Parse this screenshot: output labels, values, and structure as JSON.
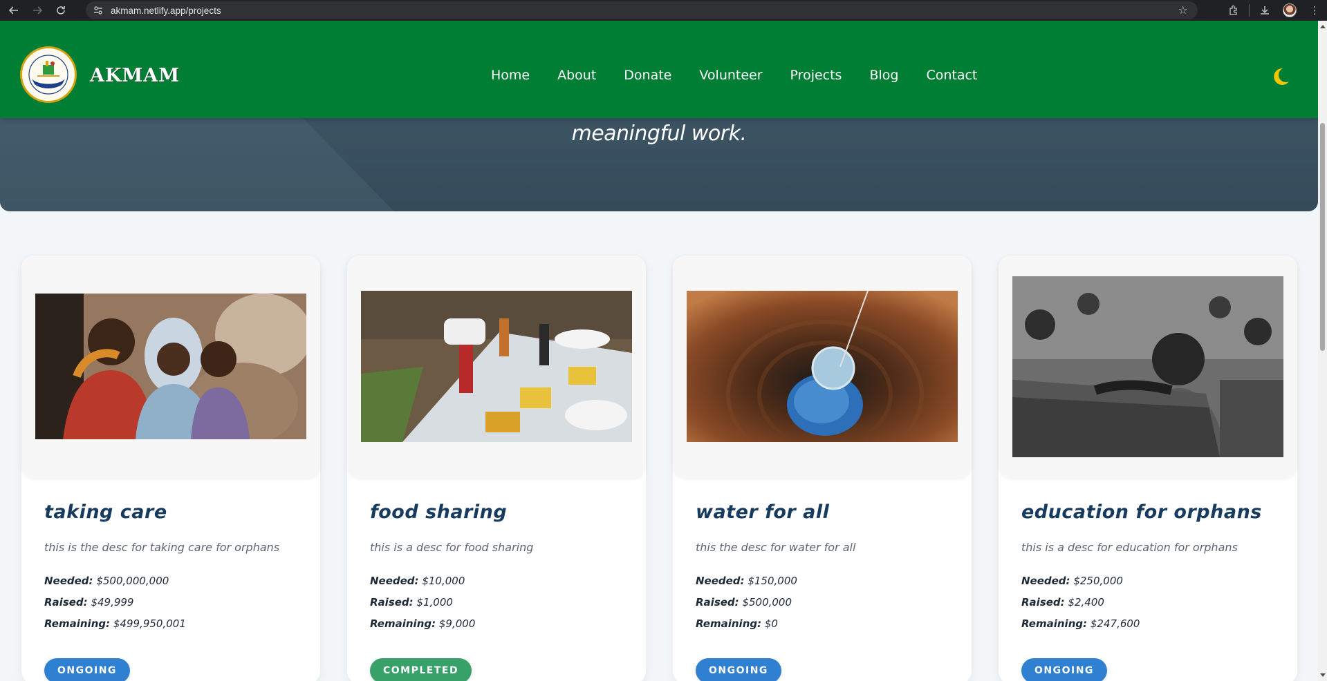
{
  "browser": {
    "url": "akmam.netlify.app/projects",
    "back_icon": "arrow-left-icon",
    "forward_icon": "arrow-right-icon",
    "reload_icon": "reload-icon"
  },
  "header": {
    "brand": "AKMAM",
    "nav": [
      "Home",
      "About",
      "Donate",
      "Volunteer",
      "Projects",
      "Blog",
      "Contact"
    ],
    "theme_icon": "moon-icon",
    "colors": {
      "header_bg": "#007f34",
      "moon": "#f5c400"
    }
  },
  "hero": {
    "tagline": "meaningful work."
  },
  "labels": {
    "needed": "Needed:",
    "raised": "Raised:",
    "remaining": "Remaining:"
  },
  "projects": [
    {
      "title": "taking care",
      "desc": "this is the desc for taking care for orphans",
      "needed": "$500,000,000",
      "raised": "$49,999",
      "remaining": "$499,950,001",
      "status": "ONGOING",
      "status_color": "#2f80d1"
    },
    {
      "title": "food sharing",
      "desc": "this is a desc for food sharing",
      "needed": "$10,000",
      "raised": "$1,000",
      "remaining": "$9,000",
      "status": "COMPLETED",
      "status_color": "#38a169"
    },
    {
      "title": "water for all",
      "desc": "this the desc for water for all",
      "needed": "$150,000",
      "raised": "$500,000",
      "remaining": "$0",
      "status": "ONGOING",
      "status_color": "#2f80d1"
    },
    {
      "title": "education for orphans",
      "desc": "this is a desc for education for orphans",
      "needed": "$250,000",
      "raised": "$2,400",
      "remaining": "$247,600",
      "status": "ONGOING",
      "status_color": "#2f80d1"
    }
  ]
}
